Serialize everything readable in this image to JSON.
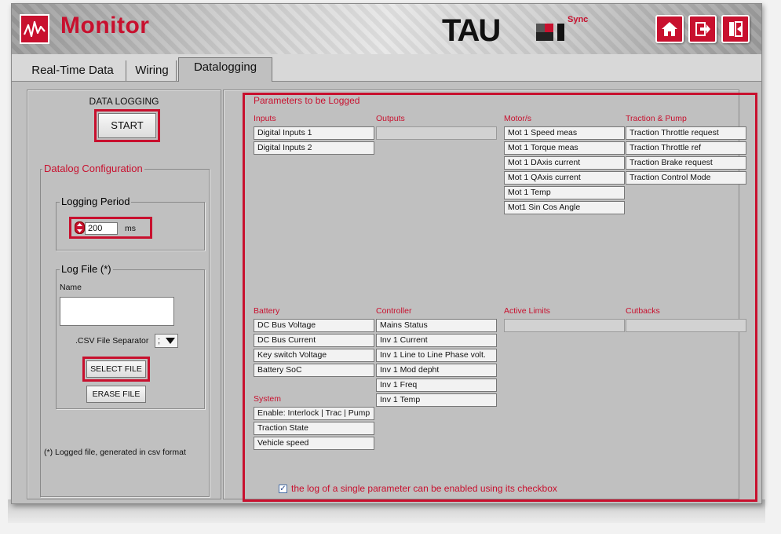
{
  "header": {
    "title": "Monitor",
    "brand": "TAU",
    "brand_sup": "Sync",
    "icons": [
      "monitor-logo-icon",
      "home-icon",
      "exit-icon",
      "logout-icon"
    ],
    "accent_color": "#c8102e"
  },
  "tabs": [
    {
      "label": "Real-Time Data",
      "active": false
    },
    {
      "label": "Wiring",
      "active": false
    },
    {
      "label": "Datalogging",
      "active": true
    }
  ],
  "left": {
    "data_logging_title": "DATA LOGGING",
    "start_label": "START",
    "config_group": "Datalog Configuration",
    "period_group": "Logging Period",
    "period_value": "200",
    "period_unit": "ms",
    "logfile_group": "Log File (*)",
    "name_label": "Name",
    "name_value": "",
    "separator_label": ".CSV File Separator",
    "separator_value": ";",
    "select_file_label": "SELECT FILE",
    "erase_file_label": "ERASE FILE",
    "footnote": "(*) Logged file, generated in csv format"
  },
  "params": {
    "title": "Parameters to be Logged",
    "sections": {
      "inputs": {
        "title": "Inputs",
        "items": [
          "Digital Inputs 1",
          "Digital Inputs 2"
        ]
      },
      "outputs": {
        "title": "Outputs",
        "items": [
          ""
        ]
      },
      "motors": {
        "title": "Motor/s",
        "items": [
          "Mot 1 Speed meas",
          "Mot 1 Torque meas",
          "Mot 1 DAxis current",
          "Mot 1 QAxis current",
          "Mot 1 Temp",
          "Mot1 Sin Cos Angle"
        ]
      },
      "traction": {
        "title": "Traction & Pump",
        "items": [
          "Traction Throttle request",
          "Traction Throttle ref",
          "Traction Brake request",
          "Traction Control Mode"
        ]
      },
      "battery": {
        "title": "Battery",
        "items": [
          "DC Bus Voltage",
          "DC Bus Current",
          "Key switch Voltage",
          "Battery SoC"
        ]
      },
      "controller": {
        "title": "Controller",
        "items": [
          "Mains Status",
          "Inv 1 Current",
          "Inv 1 Line to Line Phase volt.",
          "Inv 1 Mod depht",
          "Inv 1 Freq",
          "Inv 1 Temp"
        ]
      },
      "limits": {
        "title": "Active Limits",
        "items": [
          ""
        ]
      },
      "cutbacks": {
        "title": "Cutbacks",
        "items": [
          ""
        ]
      },
      "system": {
        "title": "System",
        "items": [
          "Enable: Interlock | Trac | Pump",
          "Traction State",
          "Vehicle speed"
        ]
      }
    },
    "note": "the log of a single parameter can be enabled using its checkbox",
    "note_checked": true
  }
}
